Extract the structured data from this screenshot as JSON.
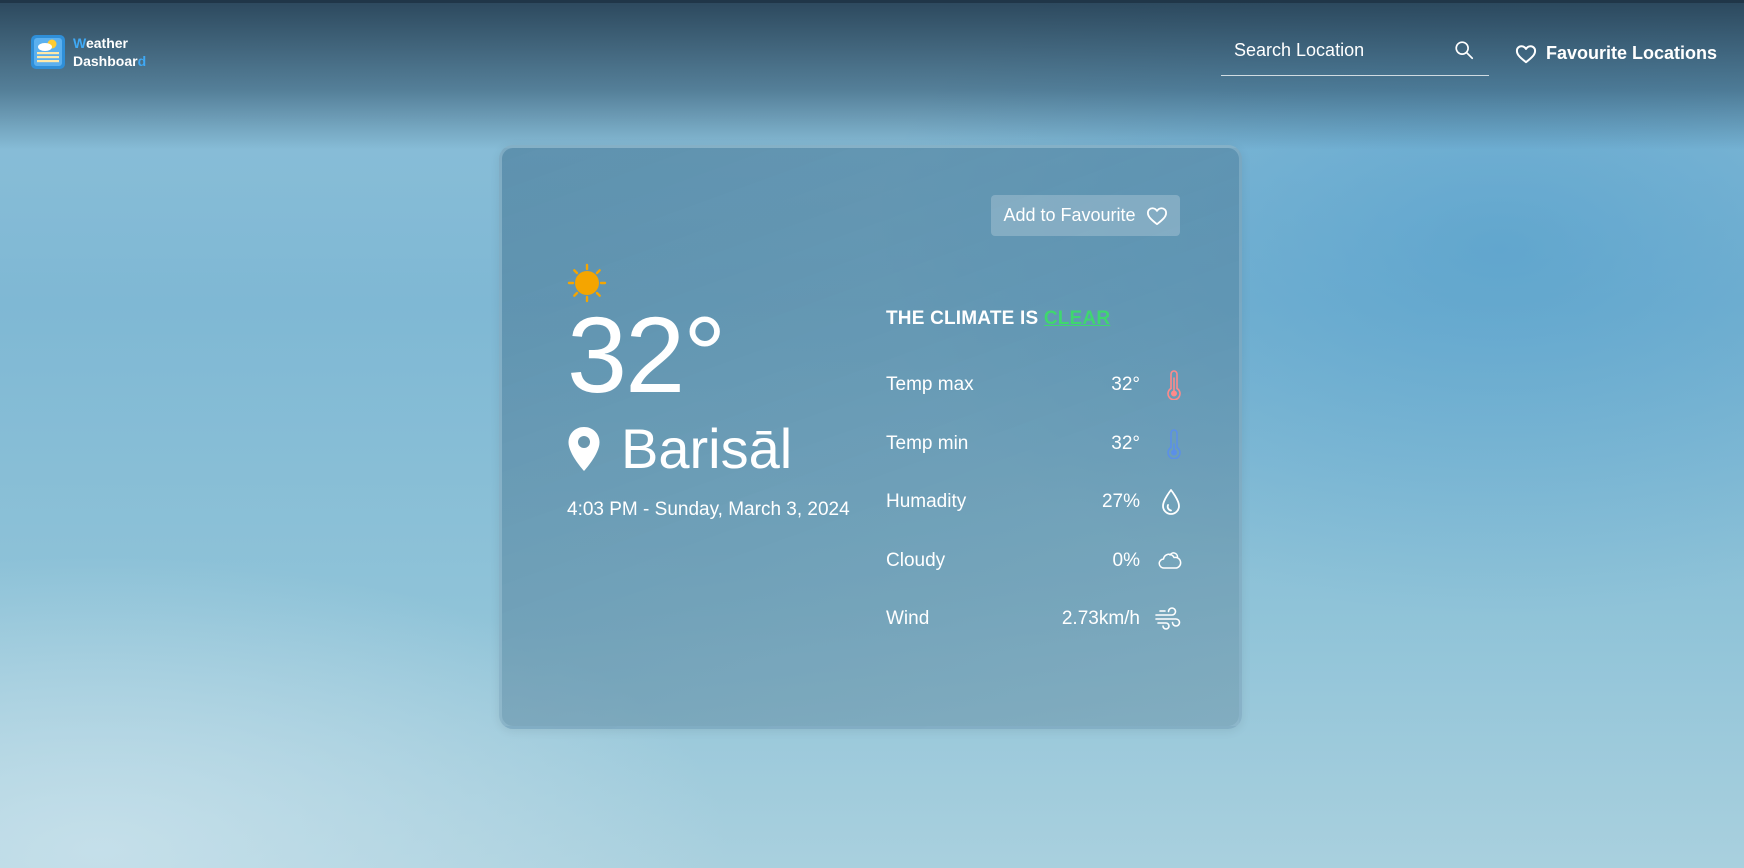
{
  "app": {
    "brand_line1_first": "W",
    "brand_line1_rest": "eather",
    "brand_line2_main": "Dashboar",
    "brand_line2_last": "d"
  },
  "header": {
    "search_placeholder": "Search Location",
    "favourites_label": "Favourite Locations"
  },
  "card": {
    "add_favourite_label": "Add to Favourite",
    "temperature": "32°",
    "city": "Barisāl",
    "datetime": "4:03 PM - Sunday, March 3, 2024",
    "climate_prefix": "THE CLIMATE IS",
    "climate_state": "CLEAR",
    "stats": [
      {
        "label": "Temp max",
        "value": "32°",
        "icon": "thermometer-max-icon"
      },
      {
        "label": "Temp min",
        "value": "32°",
        "icon": "thermometer-min-icon"
      },
      {
        "label": "Humadity",
        "value": "27%",
        "icon": "droplet-icon"
      },
      {
        "label": "Cloudy",
        "value": "0%",
        "icon": "cloud-icon"
      },
      {
        "label": "Wind",
        "value": "2.73km/h",
        "icon": "wind-icon"
      }
    ]
  },
  "colors": {
    "brand_accent": "#3fa9f5",
    "climate_state": "#3fd76f",
    "sun": "#f5a500",
    "temp_max_icon": "#ff8a8a",
    "temp_min_icon": "#5b8fe8"
  }
}
